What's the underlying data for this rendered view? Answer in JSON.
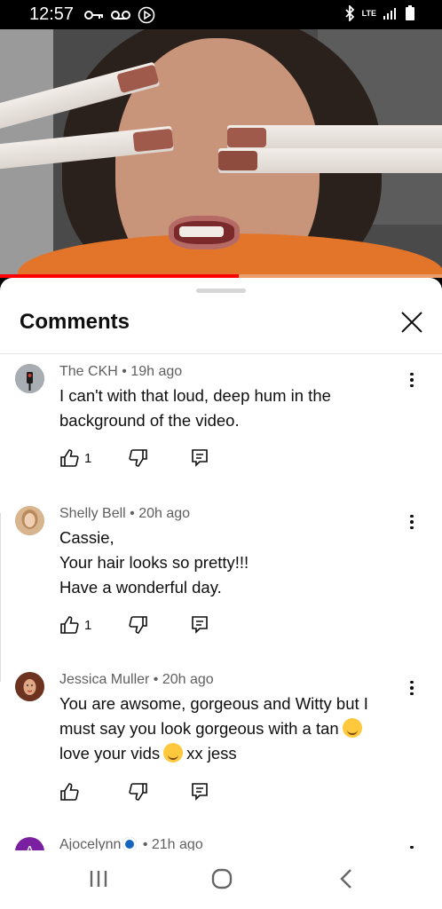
{
  "status_bar": {
    "time": "12:57",
    "left_icons": [
      "key-icon",
      "voicemail-icon",
      "play-circle-icon"
    ],
    "right_icons": [
      "bluetooth-icon",
      "lte-icon",
      "signal-icon",
      "battery-icon"
    ],
    "network": "LTE"
  },
  "video": {
    "progress": 0.54,
    "accent_color": "#ff0000"
  },
  "comments_panel": {
    "title": "Comments",
    "close_icon": "close-icon",
    "comments": [
      {
        "author": "The CKH",
        "time": "19h ago",
        "lines": [
          "I can't with that loud, deep hum in the",
          "background of the video."
        ],
        "likes": "1"
      },
      {
        "author": "Shelly Bell",
        "time": "20h ago",
        "lines": [
          "Cassie,",
          "Your hair looks so pretty!!!",
          "Have a wonderful day."
        ],
        "likes": "1"
      },
      {
        "author": "Jessica Muller",
        "time": "20h ago",
        "lines": [
          "You are awsome, gorgeous and Witty but I",
          "must say you look gorgeous with a tan",
          "love your vids",
          "xx jess"
        ],
        "likes": ""
      },
      {
        "author": "Ajocelynn",
        "time": "21h ago",
        "avatar_letter": "A",
        "avatar_color": "#7b1fa2"
      }
    ]
  },
  "nav_bar": {
    "buttons": [
      "recent-apps-icon",
      "home-icon",
      "back-icon"
    ]
  }
}
